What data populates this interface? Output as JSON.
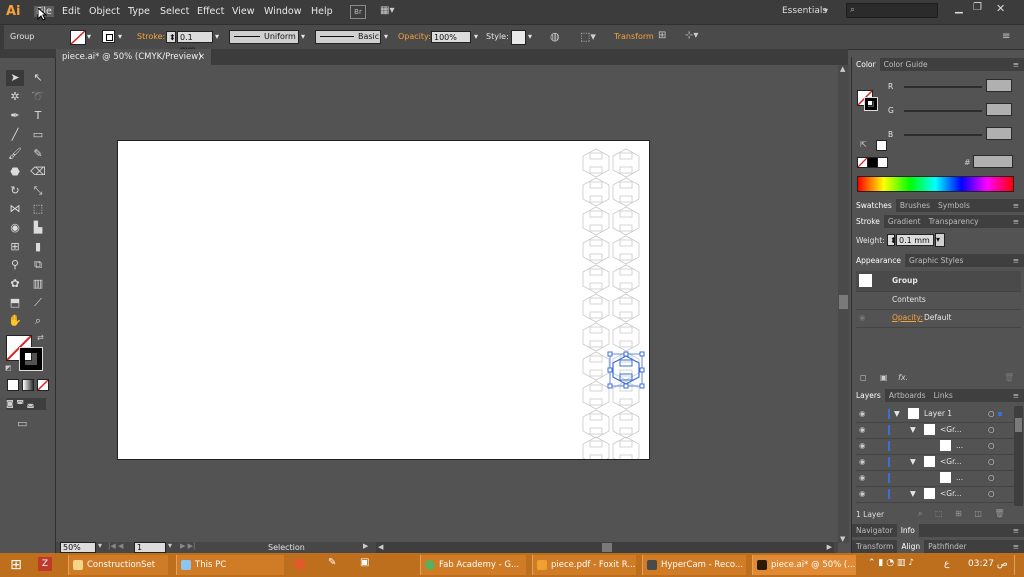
{
  "app": {
    "logo": "Ai",
    "menus": [
      "File",
      "Edit",
      "Object",
      "Type",
      "Select",
      "Effect",
      "View",
      "Window",
      "Help"
    ],
    "active_menu": "File",
    "workspace": "Essentials",
    "search_placeholder": ""
  },
  "control_bar": {
    "selection_type": "Group",
    "stroke_label": "Stroke:",
    "stroke_value": "0.1 mm",
    "profile": "Uniform",
    "brush": "Basic",
    "opacity_label": "Opacity:",
    "opacity_value": "100%",
    "style_label": "Style:",
    "transform_label": "Transform"
  },
  "document": {
    "tab_title": "piece.ai* @ 50% (CMYK/Preview)",
    "close": "×"
  },
  "status_bar": {
    "zoom": "50%",
    "artboard_number": "1",
    "tool_status": "Selection"
  },
  "panels": {
    "color": {
      "tabs": [
        "Color",
        "Color Guide"
      ],
      "channels": [
        "R",
        "G",
        "B"
      ],
      "hex_label": "#"
    },
    "swatches_tabs": [
      "Swatches",
      "Brushes",
      "Symbols"
    ],
    "stroke": {
      "tabs": [
        "Stroke",
        "Gradient",
        "Transparency"
      ],
      "weight_label": "Weight:",
      "weight_value": "0.1 mm"
    },
    "appearance": {
      "tabs": [
        "Appearance",
        "Graphic Styles"
      ],
      "item": "Group",
      "contents": "Contents",
      "opacity_label": "Opacity:",
      "opacity_value": "Default",
      "fx": "fx."
    },
    "layers": {
      "tabs": [
        "Layers",
        "Artboards",
        "Links"
      ],
      "rows": [
        "Layer 1",
        "<Gr...",
        "...",
        "<Gr...",
        "...",
        "<Gr..."
      ],
      "count": "1 Layer"
    },
    "bottom1_tabs": [
      "Navigator",
      "Info"
    ],
    "bottom2_tabs": [
      "Transform",
      "Align",
      "Pathfinder"
    ]
  },
  "taskbar": {
    "items": [
      "ConstructionSet",
      "This PC",
      "Fab Academy - G...",
      "piece.pdf - Foxit R...",
      "HyperCam - Reco...",
      "piece.ai* @ 50% (..."
    ],
    "lang": "ع",
    "time": "03:27 ص"
  },
  "colors": {
    "menubar": "#3c3c3c",
    "workspace": "#535353",
    "accent": "#f6a23a",
    "selection_blue": "#3b6fd8",
    "taskbar": "#bd6f1e"
  }
}
